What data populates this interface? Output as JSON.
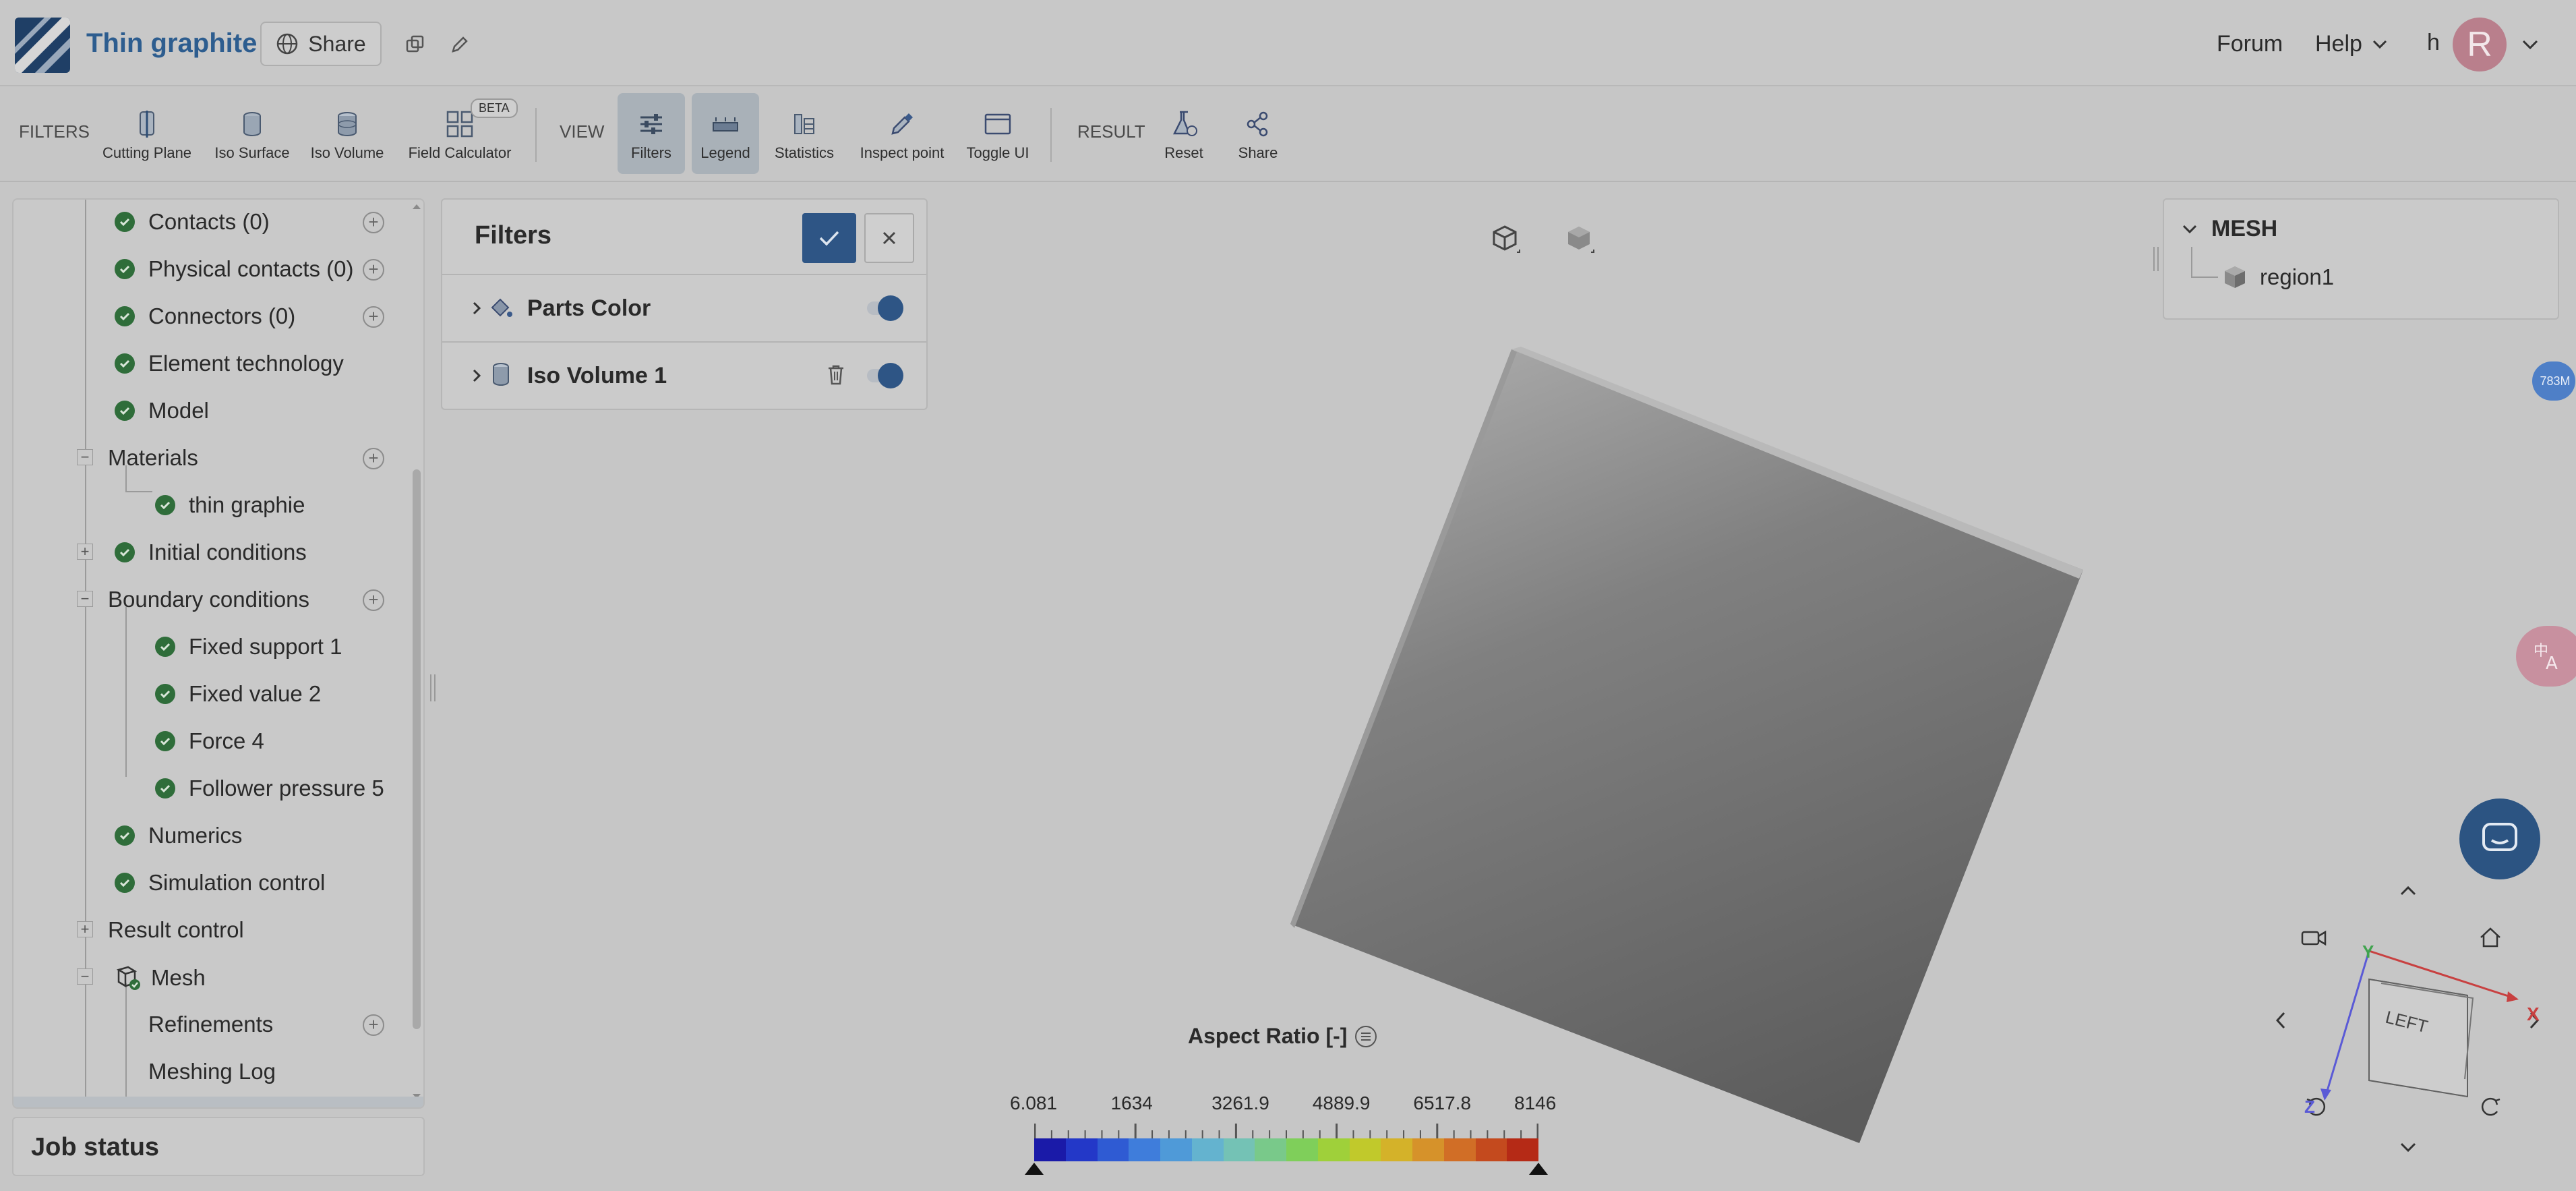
{
  "header": {
    "title": "Thin graphite",
    "share_label": "Share",
    "forum_label": "Forum",
    "help_label": "Help",
    "user_initial": "h",
    "avatar_letter": "R"
  },
  "toolbar": {
    "filters_group": "FILTERS",
    "view_group": "VIEW",
    "result_group": "RESULT",
    "cutting_plane": "Cutting Plane",
    "iso_surface": "Iso Surface",
    "iso_volume": "Iso Volume",
    "field_calculator": "Field Calculator",
    "beta_badge": "BETA",
    "filters": "Filters",
    "legend": "Legend",
    "statistics": "Statistics",
    "inspect_point": "Inspect point",
    "toggle_ui": "Toggle UI",
    "reset": "Reset",
    "share": "Share"
  },
  "tree": {
    "contacts": "Contacts (0)",
    "physical_contacts": "Physical contacts (0)",
    "connectors": "Connectors (0)",
    "element_technology": "Element technology",
    "model": "Model",
    "materials": "Materials",
    "thin_graphie": "thin graphie",
    "initial_conditions": "Initial conditions",
    "boundary_conditions": "Boundary conditions",
    "fixed_support_1": "Fixed support 1",
    "fixed_value_2": "Fixed value 2",
    "force_4": "Force 4",
    "follower_pressure_5": "Follower pressure 5",
    "numerics": "Numerics",
    "simulation_control": "Simulation control",
    "result_control": "Result control",
    "mesh": "Mesh",
    "refinements": "Refinements",
    "meshing_log": "Meshing Log"
  },
  "job_status": "Job status",
  "filters_panel": {
    "title": "Filters",
    "parts_color": "Parts Color",
    "iso_volume_1": "Iso Volume 1"
  },
  "mesh_panel": {
    "title": "MESH",
    "region": "region1"
  },
  "memory_badge": "783M",
  "legend": {
    "title": "Aspect Ratio [-]",
    "ticks": [
      "6.081",
      "1634",
      "3261.9",
      "4889.9",
      "6517.8",
      "8146"
    ],
    "colors": [
      "#1a1aa8",
      "#2338c8",
      "#2f5bd3",
      "#3f7ddb",
      "#4f9ad8",
      "#64b3cf",
      "#74c2b5",
      "#79c98a",
      "#7fcf5a",
      "#9fd03a",
      "#c1c92b",
      "#d4b229",
      "#d6922a",
      "#d16e26",
      "#c44a1e",
      "#b52a16"
    ]
  },
  "gizmo": {
    "face_label": "LEFT",
    "axis_x": "X",
    "axis_y": "Y",
    "axis_z": "Z"
  }
}
